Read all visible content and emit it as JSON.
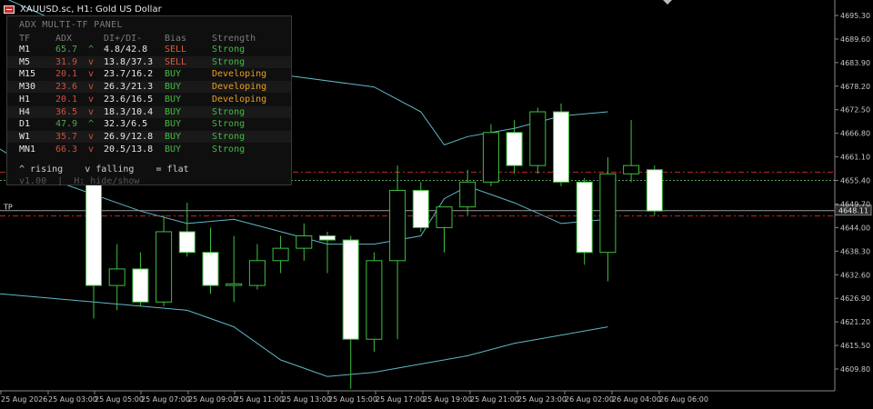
{
  "window": {
    "title": "XAUUSD.sc, H1:  Gold US Dollar"
  },
  "panel": {
    "title": "ADX MULTI-TF PANEL",
    "headers": [
      "TF",
      "ADX",
      "DI+/DI-",
      "Bias",
      "Strength"
    ],
    "rows": [
      {
        "tf": "M1",
        "adx": "65.7",
        "dir": "^",
        "di": "4.8/42.8",
        "bias": "SELL",
        "strength": "Strong"
      },
      {
        "tf": "M5",
        "adx": "31.9",
        "dir": "v",
        "di": "13.8/37.3",
        "bias": "SELL",
        "strength": "Strong"
      },
      {
        "tf": "M15",
        "adx": "20.1",
        "dir": "v",
        "di": "23.7/16.2",
        "bias": "BUY",
        "strength": "Developing"
      },
      {
        "tf": "M30",
        "adx": "23.6",
        "dir": "v",
        "di": "26.3/21.3",
        "bias": "BUY",
        "strength": "Developing"
      },
      {
        "tf": "H1",
        "adx": "20.1",
        "dir": "v",
        "di": "23.6/16.5",
        "bias": "BUY",
        "strength": "Developing"
      },
      {
        "tf": "H4",
        "adx": "36.5",
        "dir": "v",
        "di": "18.3/10.4",
        "bias": "BUY",
        "strength": "Strong"
      },
      {
        "tf": "D1",
        "adx": "47.9",
        "dir": "^",
        "di": "32.3/6.5",
        "bias": "BUY",
        "strength": "Strong"
      },
      {
        "tf": "W1",
        "adx": "35.7",
        "dir": "v",
        "di": "26.9/12.8",
        "bias": "BUY",
        "strength": "Strong"
      },
      {
        "tf": "MN1",
        "adx": "66.3",
        "dir": "v",
        "di": "20.5/13.8",
        "bias": "BUY",
        "strength": "Strong"
      }
    ],
    "legend": "^ rising    v falling    = flat",
    "footer": "v1.00  |  H: hide/show"
  },
  "chart_data": {
    "type": "candlestick",
    "y_ticks": [
      4695.3,
      4689.6,
      4683.9,
      4678.2,
      4672.5,
      4666.8,
      4661.1,
      4655.4,
      4649.7,
      4644.0,
      4638.3,
      4632.6,
      4626.9,
      4621.2,
      4615.5,
      4609.8
    ],
    "ylim": [
      4604.0,
      4698.0
    ],
    "x_labels": [
      "25 Aug 2026",
      "25 Aug 03:00",
      "25 Aug 05:00",
      "25 Aug 07:00",
      "25 Aug 09:00",
      "25 Aug 11:00",
      "25 Aug 13:00",
      "25 Aug 15:00",
      "25 Aug 17:00",
      "25 Aug 19:00",
      "25 Aug 21:00",
      "25 Aug 23:00",
      "26 Aug 02:00",
      "26 Aug 04:00",
      "26 Aug 06:00"
    ],
    "current_price": "4648.11",
    "tp_label": "TP",
    "levels": {
      "tp": 4647.0,
      "red_upper": 4657.4,
      "green": 4655.4,
      "red_lower": 4646.8,
      "current": 4648.11
    },
    "candles": [
      {
        "o": 4661,
        "h": 4664,
        "l": 4622,
        "c": 4630
      },
      {
        "o": 4630,
        "h": 4640,
        "l": 4624,
        "c": 4634
      },
      {
        "o": 4634,
        "h": 4638,
        "l": 4625,
        "c": 4626
      },
      {
        "o": 4626,
        "h": 4647,
        "l": 4625,
        "c": 4643
      },
      {
        "o": 4643,
        "h": 4650,
        "l": 4637,
        "c": 4638
      },
      {
        "o": 4638,
        "h": 4644,
        "l": 4628,
        "c": 4630
      },
      {
        "o": 4630,
        "h": 4642,
        "l": 4626,
        "c": 4630.4
      },
      {
        "o": 4630,
        "h": 4640,
        "l": 4629,
        "c": 4636
      },
      {
        "o": 4636,
        "h": 4642,
        "l": 4633,
        "c": 4639
      },
      {
        "o": 4639,
        "h": 4645,
        "l": 4636,
        "c": 4642
      },
      {
        "o": 4642,
        "h": 4643,
        "l": 4633,
        "c": 4641
      },
      {
        "o": 4641,
        "h": 4642,
        "l": 4605,
        "c": 4617
      },
      {
        "o": 4617,
        "h": 4638,
        "l": 4614,
        "c": 4636
      },
      {
        "o": 4636,
        "h": 4659,
        "l": 4617,
        "c": 4653
      },
      {
        "o": 4653,
        "h": 4655,
        "l": 4643,
        "c": 4644
      },
      {
        "o": 4644,
        "h": 4649,
        "l": 4638,
        "c": 4649
      },
      {
        "o": 4649,
        "h": 4658,
        "l": 4647,
        "c": 4655
      },
      {
        "o": 4655,
        "h": 4669,
        "l": 4654,
        "c": 4667
      },
      {
        "o": 4667,
        "h": 4670,
        "l": 4657,
        "c": 4659
      },
      {
        "o": 4659,
        "h": 4673,
        "l": 4657,
        "c": 4672
      },
      {
        "o": 4672,
        "h": 4674,
        "l": 4654,
        "c": 4655
      },
      {
        "o": 4655,
        "h": 4656,
        "l": 4635,
        "c": 4638
      },
      {
        "o": 4638,
        "h": 4661,
        "l": 4631,
        "c": 4657
      },
      {
        "o": 4657,
        "h": 4670,
        "l": 4655,
        "c": 4659
      },
      {
        "o": 4658,
        "h": 4659,
        "l": 4647,
        "c": 4648
      }
    ],
    "bands": {
      "upper": [
        [
          0,
          4700
        ],
        [
          4,
          4690
        ],
        [
          8,
          4684
        ],
        [
          12,
          4681
        ],
        [
          16,
          4678
        ],
        [
          18,
          4672
        ],
        [
          19,
          4664
        ],
        [
          20,
          4666
        ],
        [
          22,
          4668
        ],
        [
          24,
          4671
        ],
        [
          26,
          4672
        ]
      ],
      "middle": [
        [
          0,
          4663
        ],
        [
          2,
          4656
        ],
        [
          4,
          4652
        ],
        [
          6,
          4648
        ],
        [
          8,
          4645
        ],
        [
          10,
          4646
        ],
        [
          12,
          4643
        ],
        [
          14,
          4640
        ],
        [
          16,
          4640
        ],
        [
          18,
          4642
        ],
        [
          19,
          4651
        ],
        [
          20,
          4654
        ],
        [
          22,
          4650
        ],
        [
          24,
          4645
        ],
        [
          26,
          4646
        ]
      ],
      "lower": [
        [
          0,
          4628
        ],
        [
          4,
          4626
        ],
        [
          8,
          4624
        ],
        [
          10,
          4620
        ],
        [
          12,
          4612
        ],
        [
          14,
          4608
        ],
        [
          16,
          4609
        ],
        [
          18,
          4611
        ],
        [
          20,
          4613
        ],
        [
          22,
          4616
        ],
        [
          24,
          4618
        ],
        [
          26,
          4620
        ]
      ]
    }
  }
}
